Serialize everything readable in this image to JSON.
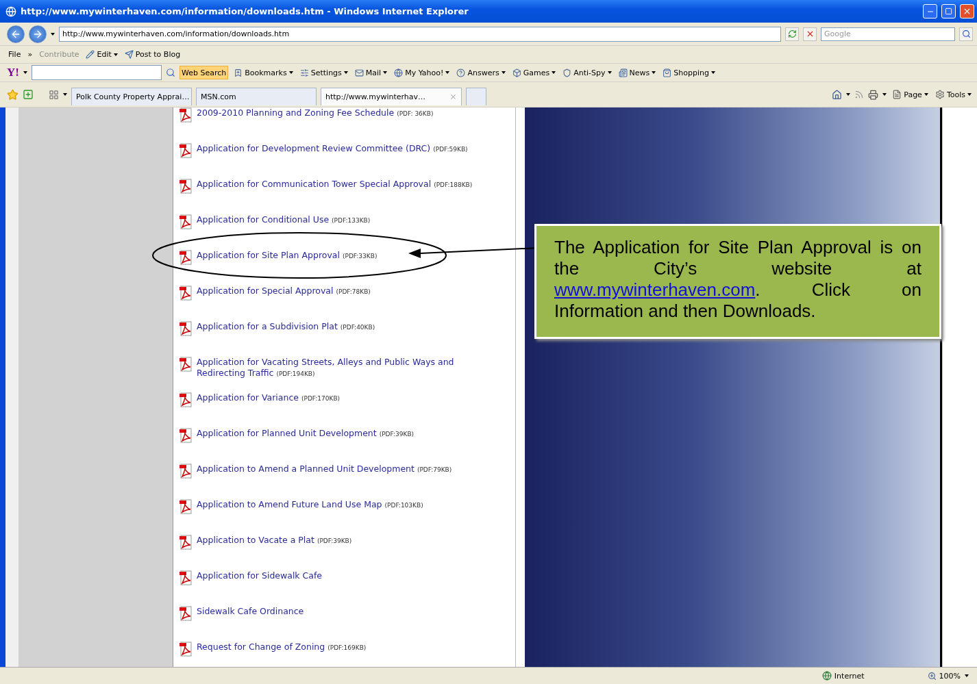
{
  "window": {
    "title": "http://www.mywinterhaven.com/information/downloads.htm - Windows Internet Explorer"
  },
  "address_bar": {
    "url": "http://www.mywinterhaven.com/information/downloads.htm",
    "search_placeholder": "Google"
  },
  "menu_bar": [
    {
      "label": "File",
      "kind": "menu",
      "disabled": false,
      "dropdown": false
    },
    {
      "label": "»",
      "kind": "chevron",
      "disabled": false,
      "dropdown": false
    },
    {
      "label": "Contribute",
      "kind": "menu",
      "disabled": true,
      "dropdown": false
    },
    {
      "label": "Edit",
      "kind": "icon",
      "disabled": false,
      "dropdown": true
    },
    {
      "label": "Post to Blog",
      "kind": "icon",
      "disabled": false,
      "dropdown": false
    }
  ],
  "yahoo_toolbar": {
    "logo": "Y!",
    "search_button": "Web Search",
    "items": [
      {
        "label": "Bookmarks",
        "dropdown": true
      },
      {
        "label": "Settings",
        "dropdown": true
      },
      {
        "label": "Mail",
        "dropdown": true
      },
      {
        "label": "My Yahoo!",
        "dropdown": true
      },
      {
        "label": "Answers",
        "dropdown": true
      },
      {
        "label": "Games",
        "dropdown": true
      },
      {
        "label": "Anti-Spy",
        "dropdown": true
      },
      {
        "label": "News",
        "dropdown": true
      },
      {
        "label": "Shopping",
        "dropdown": true
      }
    ]
  },
  "tabs": [
    {
      "label": "Polk County Property Apprai…",
      "selected": false
    },
    {
      "label": "MSN.com",
      "selected": false
    },
    {
      "label": "http://www.mywinterhav…",
      "selected": true
    }
  ],
  "command_bar": [
    {
      "label": "Page"
    },
    {
      "label": "Tools"
    }
  ],
  "documents": [
    {
      "title": "2009-2010 Planning and Zoning Fee Schedule",
      "size": "(PDF: 36KB)"
    },
    {
      "title": "Application for Development Review Committee (DRC)",
      "size": "(PDF:59KB)"
    },
    {
      "title": "Application for Communication Tower Special Approval",
      "size": "(PDF:188KB)"
    },
    {
      "title": "Application for Conditional Use",
      "size": "(PDF:133KB)"
    },
    {
      "title": "Application for Site Plan Approval",
      "size": "(PDF:33KB)"
    },
    {
      "title": "Application for Special Approval",
      "size": "(PDF:78KB)"
    },
    {
      "title": "Application for a Subdivision Plat",
      "size": "(PDF:40KB)"
    },
    {
      "title": "Application for Vacating Streets, Alleys and Public Ways and Redirecting Traffic",
      "size": "(PDF:194KB)"
    },
    {
      "title": "Application for Variance",
      "size": "(PDF:170KB)"
    },
    {
      "title": "Application for Planned Unit Development",
      "size": "(PDF:39KB)"
    },
    {
      "title": "Application to Amend a Planned Unit Development",
      "size": "(PDF:79KB)"
    },
    {
      "title": "Application to Amend Future Land Use Map",
      "size": "(PDF:103KB)"
    },
    {
      "title": "Application to Vacate a Plat",
      "size": "(PDF:39KB)"
    },
    {
      "title": "Application for Sidewalk Cafe"
    },
    {
      "title": "Sidewalk Cafe Ordinance"
    },
    {
      "title": "Request for Change of Zoning",
      "size": "(PDF:169KB)"
    }
  ],
  "callout": {
    "before": "The Application for Site Plan Approval is on the City’s website at ",
    "link": "www.mywinterhaven.com",
    "after": ". Click on Information and then Downloads."
  },
  "status_bar": {
    "zone": "Internet",
    "zoom": "100%"
  }
}
